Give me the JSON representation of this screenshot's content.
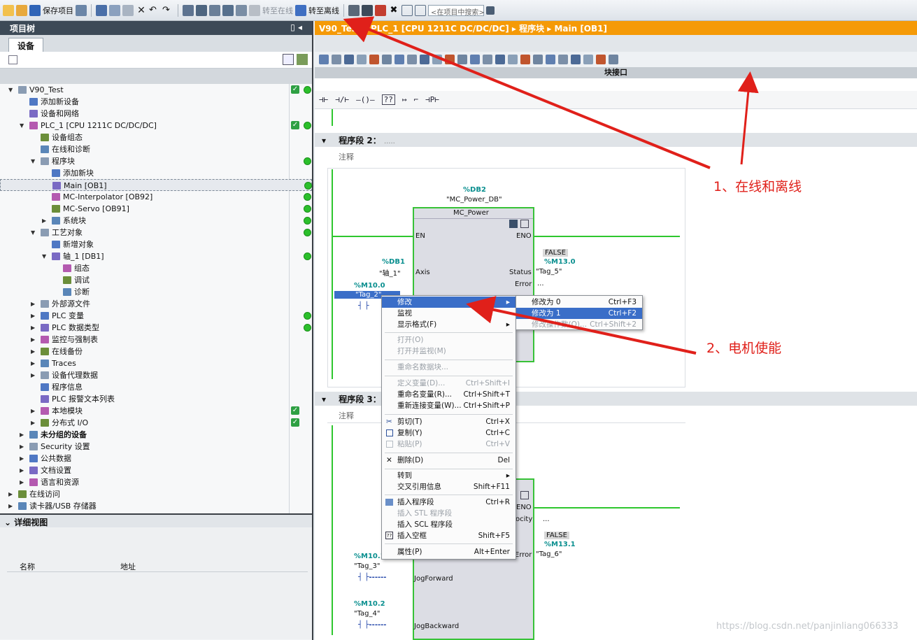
{
  "toolbar": {
    "save_project": "保存项目",
    "go_online": "转至在线",
    "go_offline": "转至离线",
    "search_placeholder": "<在项目中搜索>"
  },
  "left_panel": {
    "title": "项目树",
    "tab": "设备",
    "tree": [
      {
        "label": "V90_Test",
        "indent": 0,
        "arrow": "down",
        "status": "check"
      },
      {
        "label": "添加新设备",
        "indent": 1
      },
      {
        "label": "设备和网络",
        "indent": 1
      },
      {
        "label": "PLC_1 [CPU 1211C DC/DC/DC]",
        "indent": 1,
        "arrow": "down",
        "status": "check"
      },
      {
        "label": "设备组态",
        "indent": 2
      },
      {
        "label": "在线和诊断",
        "indent": 2
      },
      {
        "label": "程序块",
        "indent": 2,
        "arrow": "down",
        "status": "dot"
      },
      {
        "label": "添加新块",
        "indent": 3
      },
      {
        "label": "Main [OB1]",
        "indent": 3,
        "status": "dot",
        "selected": true
      },
      {
        "label": "MC-Interpolator [OB92]",
        "indent": 3,
        "status": "dot"
      },
      {
        "label": "MC-Servo [OB91]",
        "indent": 3,
        "status": "dot"
      },
      {
        "label": "系统块",
        "indent": 3,
        "arrow": "right",
        "status": "dot"
      },
      {
        "label": "工艺对象",
        "indent": 2,
        "arrow": "down",
        "status": "dot"
      },
      {
        "label": "新增对象",
        "indent": 3
      },
      {
        "label": "轴_1 [DB1]",
        "indent": 3,
        "arrow": "down",
        "status": "dot"
      },
      {
        "label": "组态",
        "indent": 4
      },
      {
        "label": "调试",
        "indent": 4
      },
      {
        "label": "诊断",
        "indent": 4
      },
      {
        "label": "外部源文件",
        "indent": 2,
        "arrow": "right"
      },
      {
        "label": "PLC 变量",
        "indent": 2,
        "arrow": "right",
        "status": "dot"
      },
      {
        "label": "PLC 数据类型",
        "indent": 2,
        "arrow": "right",
        "status": "dot"
      },
      {
        "label": "监控与强制表",
        "indent": 2,
        "arrow": "right"
      },
      {
        "label": "在线备份",
        "indent": 2,
        "arrow": "right"
      },
      {
        "label": "Traces",
        "indent": 2,
        "arrow": "right"
      },
      {
        "label": "设备代理数据",
        "indent": 2,
        "arrow": "right"
      },
      {
        "label": "程序信息",
        "indent": 2
      },
      {
        "label": "PLC 报警文本列表",
        "indent": 2
      },
      {
        "label": "本地模块",
        "indent": 2,
        "arrow": "right",
        "status": "check"
      },
      {
        "label": "分布式 I/O",
        "indent": 2,
        "arrow": "right",
        "status": "check"
      },
      {
        "label": "未分组的设备",
        "indent": 1,
        "arrow": "right",
        "bold": true
      },
      {
        "label": "Security 设置",
        "indent": 1,
        "arrow": "right"
      },
      {
        "label": "公共数据",
        "indent": 1,
        "arrow": "right"
      },
      {
        "label": "文档设置",
        "indent": 1,
        "arrow": "right"
      },
      {
        "label": "语言和资源",
        "indent": 1,
        "arrow": "right"
      },
      {
        "label": "在线访问",
        "indent": 0,
        "arrow": "right"
      },
      {
        "label": "读卡器/USB 存储器",
        "indent": 0,
        "arrow": "right"
      }
    ],
    "detail_title": "详细视图",
    "detail_col_name": "名称",
    "detail_col_addr": "地址"
  },
  "editor": {
    "breadcrumb": "V90_Test ▸ PLC_1 [CPU 1211C DC/DC/DC] ▸ 程序块 ▸ Main [OB1]",
    "block_interface": "块接口",
    "seg2_title": "程序段 2：",
    "seg2_dots": ".....",
    "seg3_title": "程序段 3：",
    "seg3_dots": ".....",
    "comment": "注释",
    "fb1": {
      "db": "%DB2",
      "db_name": "\"MC_Power_DB\"",
      "name": "MC_Power",
      "en": "EN",
      "eno": "ENO",
      "axis_pin": "Axis",
      "status_pin": "Status",
      "error_pin": "Error",
      "axis_db": "%DB1",
      "axis_tag": "\"轴_1\"",
      "input_addr": "%M10.0",
      "input_tag": "\"Tag_2\"",
      "status_val": "FALSE",
      "status_addr": "%M13.0",
      "status_tag": "\"Tag_5\"",
      "error_dots": "..."
    },
    "fb2": {
      "eno": "ENO",
      "velocity_pin": "ocity",
      "velocity_dots": "...",
      "error_pin": "Error",
      "status_val": "FALSE",
      "status_addr": "%M13.1",
      "status_tag": "\"Tag_6\"",
      "jog_fwd_addr": "%M10.1",
      "jog_fwd_tag": "\"Tag_3\"",
      "jog_fwd_pin": "JogForward",
      "jog_bwd_addr": "%M10.2",
      "jog_bwd_tag": "\"Tag_4\"",
      "jog_bwd_pin": "JogBackward"
    }
  },
  "context_menu": {
    "modify": "修改",
    "monitor": "监视",
    "display_format": "显示格式(F)",
    "open": "打开(O)",
    "open_monitor": "打开并监视(M)",
    "rename_db": "重命名数据块...",
    "define_var": "定义变量(D)...",
    "define_var_key": "Ctrl+Shift+I",
    "rename_var": "重命名变量(R)...",
    "rename_var_key": "Ctrl+Shift+T",
    "rewire_var": "重新连接变量(W)...",
    "rewire_var_key": "Ctrl+Shift+P",
    "cut": "剪切(T)",
    "cut_key": "Ctrl+X",
    "copy": "复制(Y)",
    "copy_key": "Ctrl+C",
    "paste": "粘贴(P)",
    "paste_key": "Ctrl+V",
    "delete": "删除(D)",
    "delete_key": "Del",
    "goto": "转到",
    "xref": "交叉引用信息",
    "xref_key": "Shift+F11",
    "insert_network": "插入程序段",
    "insert_network_key": "Ctrl+R",
    "insert_stl": "插入 STL 程序段",
    "insert_scl": "插入 SCL 程序段",
    "insert_box": "插入空框",
    "insert_box_key": "Shift+F5",
    "properties": "属性(P)",
    "properties_key": "Alt+Enter"
  },
  "submenu": {
    "modify_0": "修改为 0",
    "modify_0_key": "Ctrl+F3",
    "modify_1": "修改为 1",
    "modify_1_key": "Ctrl+F2",
    "modify_op": "修改操作数(O)...",
    "modify_op_key": "Ctrl+Shift+2"
  },
  "annotations": {
    "one": "1、在线和离线",
    "two": "2、电机使能"
  },
  "watermark": "https://blog.csdn.net/panjinliang066333",
  "colors": {
    "accent_orange": "#f59a07",
    "rung_green": "#2ec72e",
    "annotation_red": "#e0201a",
    "menu_highlight": "#3a6ec8"
  }
}
